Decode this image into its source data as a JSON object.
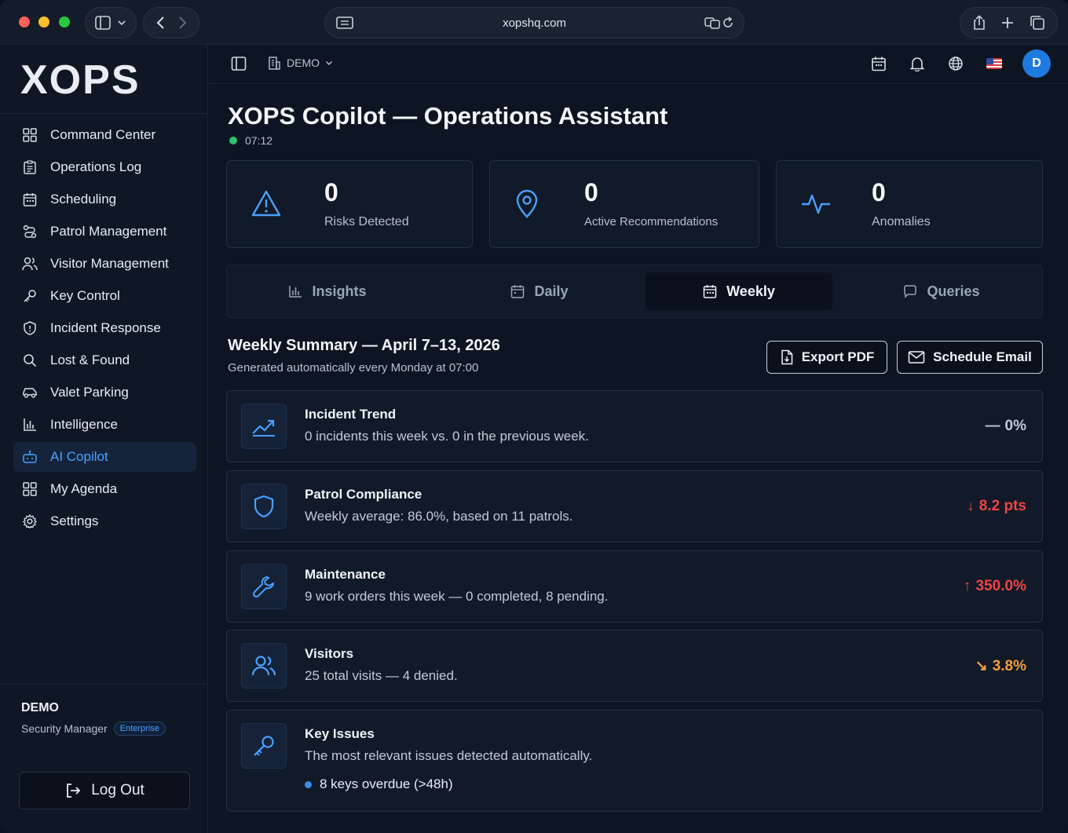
{
  "browser": {
    "url": "xopshq.com"
  },
  "brand": {
    "logo_text": "XOPS"
  },
  "sidebar": {
    "items": [
      {
        "label": "Command Center",
        "icon": "grid-icon"
      },
      {
        "label": "Operations Log",
        "icon": "clipboard-icon"
      },
      {
        "label": "Scheduling",
        "icon": "calendar-icon"
      },
      {
        "label": "Patrol Management",
        "icon": "route-icon"
      },
      {
        "label": "Visitor Management",
        "icon": "users-icon"
      },
      {
        "label": "Key Control",
        "icon": "key-icon"
      },
      {
        "label": "Incident Response",
        "icon": "shield-icon"
      },
      {
        "label": "Lost & Found",
        "icon": "search-icon"
      },
      {
        "label": "Valet Parking",
        "icon": "car-icon"
      },
      {
        "label": "Intelligence",
        "icon": "bar-chart-icon"
      },
      {
        "label": "AI Copilot",
        "icon": "bot-icon",
        "active": true
      },
      {
        "label": "My Agenda",
        "icon": "grid-icon"
      },
      {
        "label": "Settings",
        "icon": "gear-icon"
      }
    ],
    "user": {
      "name": "DEMO",
      "role": "Security Manager",
      "plan_badge": "Enterprise"
    },
    "logout_label": "Log Out"
  },
  "topbar": {
    "org": "DEMO",
    "avatar_initial": "D"
  },
  "page": {
    "title": "XOPS Copilot — Operations Assistant",
    "time": "07:12"
  },
  "stats": [
    {
      "value": "0",
      "label": "Risks Detected",
      "icon": "warning-triangle-icon"
    },
    {
      "value": "0",
      "label": "Active Recommendations",
      "icon": "map-pin-icon"
    },
    {
      "value": "0",
      "label": "Anomalies",
      "icon": "activity-icon"
    }
  ],
  "tabs": [
    {
      "label": "Insights",
      "icon": "bar-chart-icon"
    },
    {
      "label": "Daily",
      "icon": "calendar-icon"
    },
    {
      "label": "Weekly",
      "icon": "calendar-icon",
      "active": true
    },
    {
      "label": "Queries",
      "icon": "chat-icon"
    }
  ],
  "summary": {
    "title": "Weekly Summary — April 7–13, 2026",
    "subtitle": "Generated automatically every Monday at 07:00",
    "export_label": "Export PDF",
    "email_label": "Schedule Email"
  },
  "cards": [
    {
      "title": "Incident Trend",
      "desc": "0 incidents this week vs. 0 in the previous week.",
      "value": "0%",
      "arrow": "—",
      "color": "#c3cad5",
      "icon": "trend-up-icon"
    },
    {
      "title": "Patrol Compliance",
      "desc": "Weekly average: 86.0%, based on 11 patrols.",
      "value": "8.2 pts",
      "arrow": "↓",
      "color": "#ef4444",
      "icon": "shield-icon"
    },
    {
      "title": "Maintenance",
      "desc": "9 work orders this week — 0 completed, 8 pending.",
      "value": "350.0%",
      "arrow": "↑",
      "color": "#ef4444",
      "icon": "wrench-icon"
    },
    {
      "title": "Visitors",
      "desc": "25 total visits — 4 denied.",
      "value": "3.8%",
      "arrow": "↘",
      "color": "#f59e3b",
      "icon": "users-icon"
    }
  ],
  "key_issues": {
    "title": "Key Issues",
    "desc": "The most relevant issues detected automatically.",
    "items": [
      "8 keys overdue (>48h)"
    ],
    "icon": "key-icon"
  },
  "colors": {
    "accent": "#4aa0ff",
    "online": "#2fc26a",
    "negative": "#ef4444",
    "warning": "#f59e3b"
  }
}
